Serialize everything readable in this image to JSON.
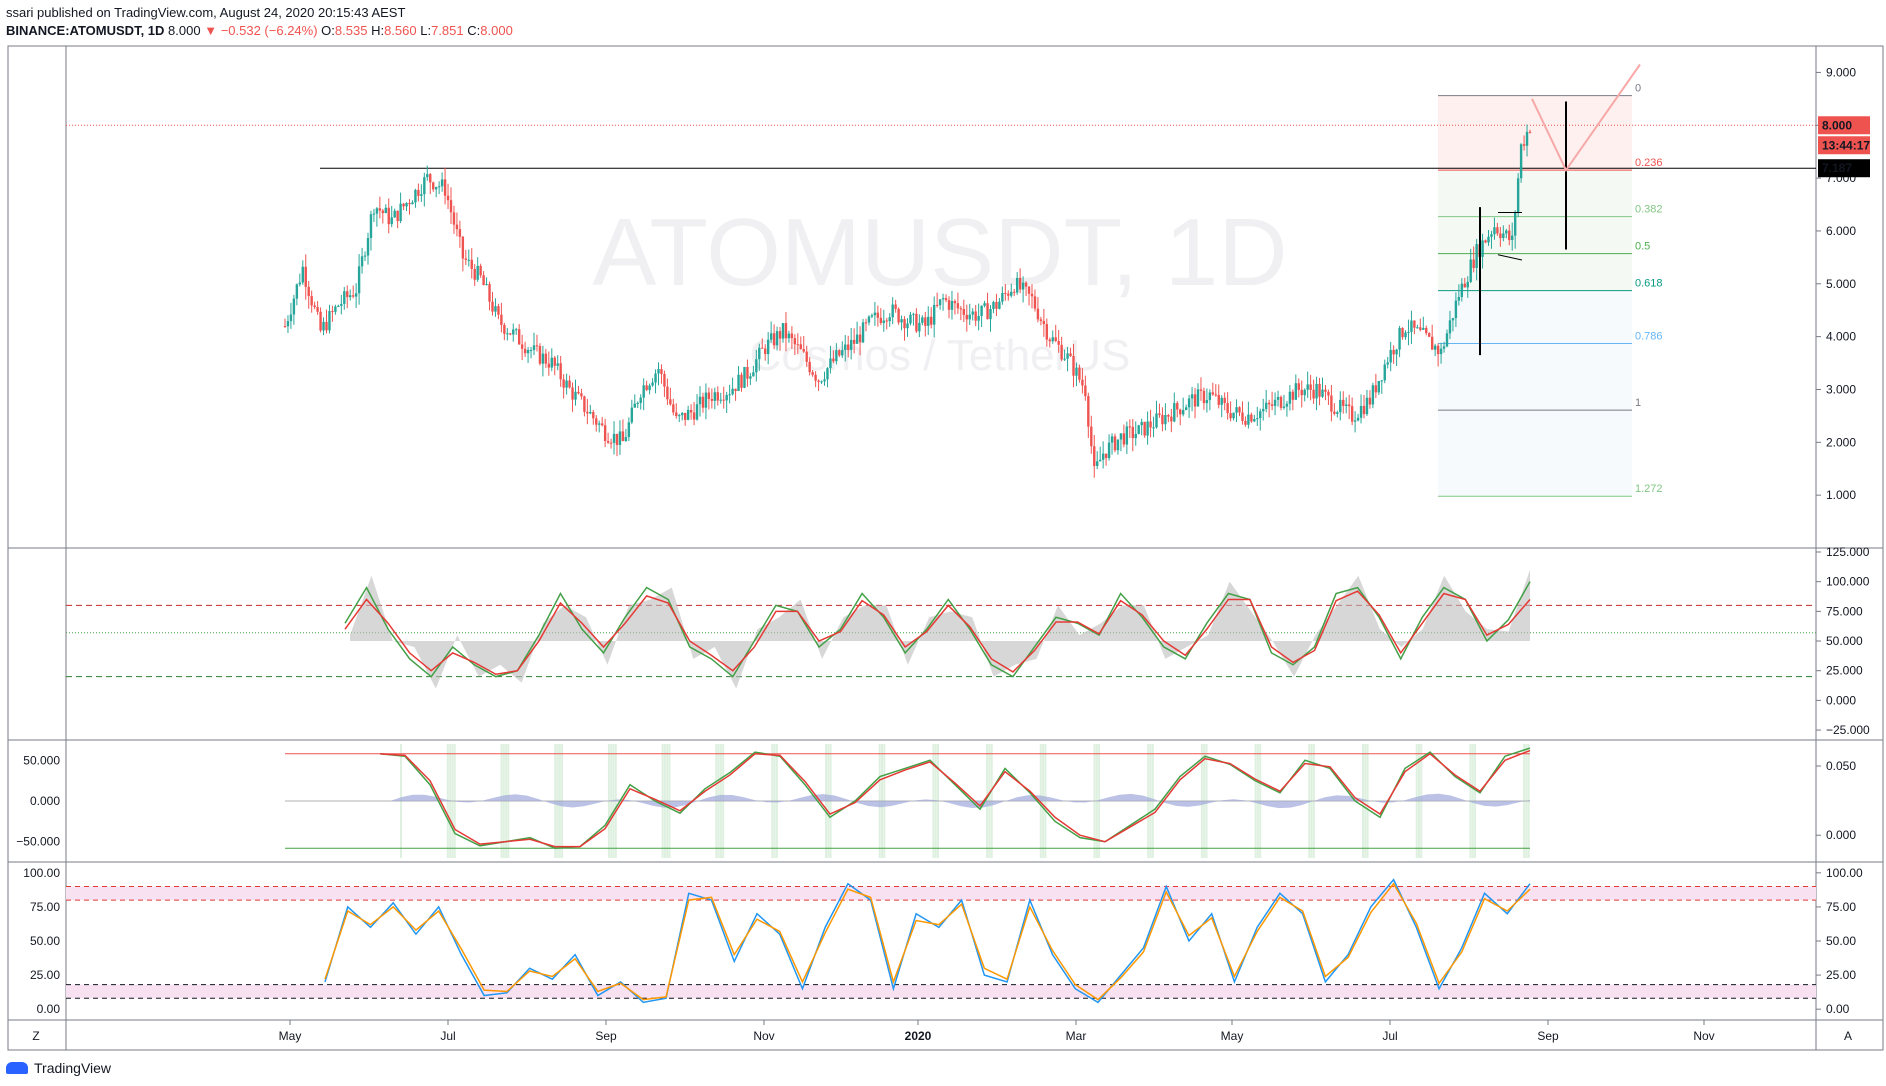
{
  "header": {
    "publisher": "ssari published on TradingView.com, August 24, 2020 20:15:43 AEST",
    "symbol": "BINANCE:ATOMUSDT, 1D",
    "last": "8.000",
    "change": "▼ −0.532 (−6.24%)",
    "o_label": "O:",
    "o_value": "8.535",
    "h_label": "H:",
    "h_value": "8.560",
    "l_label": "L:",
    "l_value": "7.851",
    "c_label": "C:",
    "c_value": "8.000"
  },
  "watermark": {
    "symbol": "ATOMUSDT, 1D",
    "name": "Cosmos / TetherUS"
  },
  "footer": {
    "logo_text": "TradingView",
    "left_button": "Z",
    "right_button": "A"
  },
  "colors": {
    "up": "#26a69a",
    "down": "#ef5350",
    "grid": "#e0e3eb",
    "text": "#131722"
  },
  "chart_data": [
    {
      "type": "candlestick",
      "pane": "price",
      "x_labels": [
        "May",
        "Jul",
        "Sep",
        "Nov",
        "2020",
        "Mar",
        "May",
        "Jul",
        "Sep",
        "Nov"
      ],
      "y_ticks": [
        "9.000",
        "8.000",
        "7.000",
        "6.000",
        "5.000",
        "4.000",
        "3.000",
        "2.000",
        "1.000"
      ],
      "ylim": [
        0,
        9.5
      ],
      "last_price_label": "8.000",
      "countdown_label": "13:44:17",
      "horizontal_line_label": "7.187",
      "horizontal_line_value": 7.187,
      "fibonacci": [
        {
          "level": "0",
          "price": 8.56,
          "color": "#787b86"
        },
        {
          "level": "0.236",
          "price": 7.15,
          "color": "#ef5350"
        },
        {
          "level": "0.382",
          "price": 6.27,
          "color": "#81c784"
        },
        {
          "level": "0.5",
          "price": 5.57,
          "color": "#4caf50"
        },
        {
          "level": "0.618",
          "price": 4.87,
          "color": "#089981"
        },
        {
          "level": "0.786",
          "price": 3.87,
          "color": "#64b5f6"
        },
        {
          "level": "1",
          "price": 2.61,
          "color": "#787b86"
        },
        {
          "level": "1.272",
          "price": 0.98,
          "color": "#81c784"
        }
      ],
      "path_points": [
        [
          0,
          4.2
        ],
        [
          2,
          5.3
        ],
        [
          4,
          4.1
        ],
        [
          6,
          4.6
        ],
        [
          8,
          4.9
        ],
        [
          10,
          6.5
        ],
        [
          12,
          6.2
        ],
        [
          14,
          6.6
        ],
        [
          16,
          7.0
        ],
        [
          18,
          6.8
        ],
        [
          20,
          5.5
        ],
        [
          22,
          5.1
        ],
        [
          24,
          4.3
        ],
        [
          26,
          4.0
        ],
        [
          28,
          3.7
        ],
        [
          30,
          3.5
        ],
        [
          32,
          3.0
        ],
        [
          34,
          2.6
        ],
        [
          36,
          2.2
        ],
        [
          38,
          2.0
        ],
        [
          40,
          3.0
        ],
        [
          42,
          3.4
        ],
        [
          44,
          2.4
        ],
        [
          46,
          2.6
        ],
        [
          48,
          2.9
        ],
        [
          50,
          3.0
        ],
        [
          52,
          3.3
        ],
        [
          54,
          3.8
        ],
        [
          56,
          4.1
        ],
        [
          58,
          3.7
        ],
        [
          60,
          3.2
        ],
        [
          62,
          3.6
        ],
        [
          64,
          3.9
        ],
        [
          66,
          4.3
        ],
        [
          68,
          4.5
        ],
        [
          70,
          4.3
        ],
        [
          72,
          4.2
        ],
        [
          74,
          4.7
        ],
        [
          76,
          4.5
        ],
        [
          78,
          4.4
        ],
        [
          80,
          4.6
        ],
        [
          82,
          5.0
        ],
        [
          84,
          4.7
        ],
        [
          86,
          4.0
        ],
        [
          88,
          3.6
        ],
        [
          90,
          3.0
        ],
        [
          91,
          1.4
        ],
        [
          92,
          1.8
        ],
        [
          94,
          2.1
        ],
        [
          96,
          2.2
        ],
        [
          98,
          2.4
        ],
        [
          100,
          2.6
        ],
        [
          102,
          2.8
        ],
        [
          104,
          2.9
        ],
        [
          106,
          2.6
        ],
        [
          108,
          2.5
        ],
        [
          110,
          2.6
        ],
        [
          112,
          2.8
        ],
        [
          114,
          3.0
        ],
        [
          116,
          3.0
        ],
        [
          118,
          2.7
        ],
        [
          120,
          2.5
        ],
        [
          122,
          2.8
        ],
        [
          124,
          3.6
        ],
        [
          126,
          4.2
        ],
        [
          128,
          4.0
        ],
        [
          130,
          3.7
        ],
        [
          132,
          4.8
        ],
        [
          134,
          5.6
        ],
        [
          136,
          6.1
        ],
        [
          138,
          5.8
        ],
        [
          139,
          7.6
        ],
        [
          140,
          8.0
        ]
      ]
    },
    {
      "type": "line",
      "pane": "oscillator-1",
      "y_ticks": [
        "125.000",
        "100.000",
        "75.000",
        "50.000",
        "25.000",
        "0.000",
        "−25.000"
      ],
      "ylim": [
        -30,
        125
      ],
      "upper_band": 80,
      "mid_line": 57,
      "lower_band": 20,
      "series": [
        {
          "color": "#43a047",
          "values": [
            65,
            95,
            60,
            35,
            20,
            45,
            30,
            20,
            25,
            55,
            90,
            60,
            40,
            70,
            95,
            85,
            45,
            35,
            20,
            50,
            80,
            75,
            45,
            60,
            90,
            70,
            40,
            60,
            85,
            60,
            30,
            20,
            45,
            70,
            65,
            55,
            90,
            70,
            45,
            35,
            65,
            90,
            85,
            40,
            30,
            45,
            90,
            95,
            70,
            35,
            70,
            95,
            85,
            50,
            68,
            100
          ]
        },
        {
          "color": "#e53935",
          "values": [
            60,
            85,
            65,
            40,
            25,
            40,
            32,
            22,
            25,
            50,
            82,
            65,
            45,
            65,
            88,
            82,
            50,
            38,
            25,
            45,
            75,
            75,
            50,
            58,
            84,
            72,
            45,
            58,
            80,
            62,
            35,
            24,
            42,
            66,
            66,
            56,
            84,
            72,
            50,
            38,
            60,
            85,
            85,
            45,
            32,
            42,
            84,
            92,
            72,
            40,
            65,
            90,
            85,
            55,
            64,
            85
          ]
        }
      ]
    },
    {
      "type": "line",
      "pane": "oscillator-2",
      "y_ticks_left": [
        "50.000",
        "0.000",
        "−50.000"
      ],
      "y_ticks_right": [
        "0.050",
        "0.000"
      ],
      "ylim": [
        -70,
        70
      ],
      "upper_line": 58,
      "lower_line": -58,
      "series": [
        {
          "color": "#43a047",
          "values": [
            58,
            55,
            20,
            -40,
            -55,
            -50,
            -45,
            -58,
            -56,
            -30,
            20,
            0,
            -15,
            15,
            35,
            60,
            55,
            20,
            -20,
            0,
            30,
            40,
            50,
            20,
            -10,
            40,
            10,
            -25,
            -45,
            -50,
            -30,
            -10,
            30,
            55,
            45,
            25,
            10,
            50,
            40,
            0,
            -20,
            40,
            60,
            30,
            10,
            55,
            65
          ]
        },
        {
          "color": "#e53935",
          "values": [
            58,
            56,
            25,
            -35,
            -53,
            -50,
            -47,
            -56,
            -56,
            -34,
            15,
            2,
            -12,
            12,
            32,
            58,
            56,
            24,
            -16,
            -2,
            26,
            38,
            48,
            22,
            -6,
            36,
            12,
            -20,
            -42,
            -50,
            -32,
            -14,
            26,
            52,
            46,
            27,
            12,
            46,
            42,
            4,
            -16,
            36,
            58,
            32,
            12,
            50,
            62
          ]
        }
      ]
    },
    {
      "type": "line",
      "pane": "stochastic",
      "y_ticks": [
        "100.00",
        "75.00",
        "50.00",
        "25.00",
        "0.00"
      ],
      "ylim": [
        -5,
        105
      ],
      "upper_band": [
        80,
        90
      ],
      "lower_band": [
        8,
        18
      ],
      "series": [
        {
          "color": "#2196f3",
          "values": [
            20,
            75,
            60,
            78,
            55,
            75,
            40,
            10,
            12,
            30,
            22,
            40,
            10,
            20,
            5,
            8,
            85,
            80,
            35,
            70,
            55,
            15,
            60,
            92,
            80,
            15,
            70,
            60,
            80,
            25,
            20,
            80,
            40,
            15,
            5,
            25,
            45,
            90,
            50,
            70,
            20,
            60,
            85,
            70,
            20,
            40,
            75,
            95,
            60,
            15,
            45,
            85,
            70,
            92
          ]
        },
        {
          "color": "#ff9800",
          "values": [
            22,
            72,
            62,
            75,
            58,
            72,
            44,
            14,
            13,
            28,
            24,
            37,
            13,
            19,
            7,
            9,
            80,
            82,
            40,
            66,
            57,
            20,
            56,
            88,
            82,
            20,
            65,
            62,
            77,
            30,
            22,
            75,
            43,
            18,
            7,
            23,
            42,
            86,
            54,
            67,
            24,
            57,
            82,
            72,
            24,
            38,
            71,
            92,
            63,
            19,
            42,
            81,
            72,
            88
          ]
        }
      ]
    }
  ]
}
